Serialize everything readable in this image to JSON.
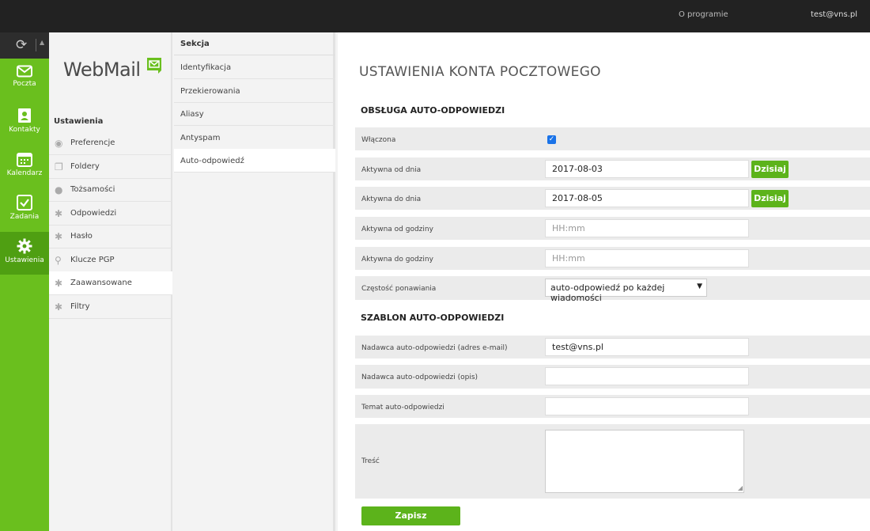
{
  "topbar": {
    "about": "O programie",
    "user": "test@vns.pl"
  },
  "rail": {
    "items": [
      {
        "label": "Poczta",
        "icon": "mail-icon"
      },
      {
        "label": "Kontakty",
        "icon": "contacts-icon"
      },
      {
        "label": "Kalendarz",
        "icon": "calendar-icon"
      },
      {
        "label": "Zadania",
        "icon": "tasks-icon"
      },
      {
        "label": "Ustawienia",
        "icon": "settings-icon"
      }
    ]
  },
  "brand": {
    "logo": "WebMail"
  },
  "settings": {
    "heading": "Ustawienia",
    "items": [
      {
        "label": "Preferencje",
        "icon": "preferences-icon"
      },
      {
        "label": "Foldery",
        "icon": "folders-icon"
      },
      {
        "label": "Tożsamości",
        "icon": "identities-icon"
      },
      {
        "label": "Odpowiedzi",
        "icon": "responses-icon"
      },
      {
        "label": "Hasło",
        "icon": "password-icon"
      },
      {
        "label": "Klucze PGP",
        "icon": "key-icon"
      },
      {
        "label": "Zaawansowane",
        "icon": "advanced-icon"
      },
      {
        "label": "Filtry",
        "icon": "filters-icon"
      }
    ]
  },
  "section": {
    "heading": "Sekcja",
    "items": [
      {
        "label": "Identyfikacja"
      },
      {
        "label": "Przekierowania"
      },
      {
        "label": "Aliasy"
      },
      {
        "label": "Antyspam"
      },
      {
        "label": "Auto-odpowiedź"
      }
    ]
  },
  "main": {
    "title": "USTAWIENIA KONTA POCZTOWEGO",
    "group1": "OBSŁUGA AUTO-ODPOWIEDZI",
    "enabled_label": "Włączona",
    "enabled": true,
    "from_date": {
      "label": "Aktywna od dnia",
      "value": "2017-08-03",
      "button": "Dzisiaj"
    },
    "to_date": {
      "label": "Aktywna do dnia",
      "value": "2017-08-05",
      "button": "Dzisiaj"
    },
    "from_hour": {
      "label": "Aktywna od godziny",
      "placeholder": "HH:mm"
    },
    "to_hour": {
      "label": "Aktywna do godziny",
      "placeholder": "HH:mm"
    },
    "frequency": {
      "label": "Częstość ponawiania",
      "value": "auto-odpowiedź po każdej wiadomości"
    },
    "group2": "SZABLON AUTO-ODPOWIEDZI",
    "sender_email": {
      "label": "Nadawca auto-odpowiedzi (adres e-mail)",
      "value": "test@vns.pl"
    },
    "sender_desc": {
      "label": "Nadawca auto-odpowiedzi (opis)",
      "value": ""
    },
    "subject": {
      "label": "Temat auto-odpowiedzi",
      "value": ""
    },
    "body": {
      "label": "Treść",
      "value": ""
    },
    "save": "Zapisz"
  },
  "colors": {
    "accent": "#5cb31b",
    "rail": "#6abf1e",
    "rail_active": "#4f9f12",
    "topbar": "#222222"
  }
}
